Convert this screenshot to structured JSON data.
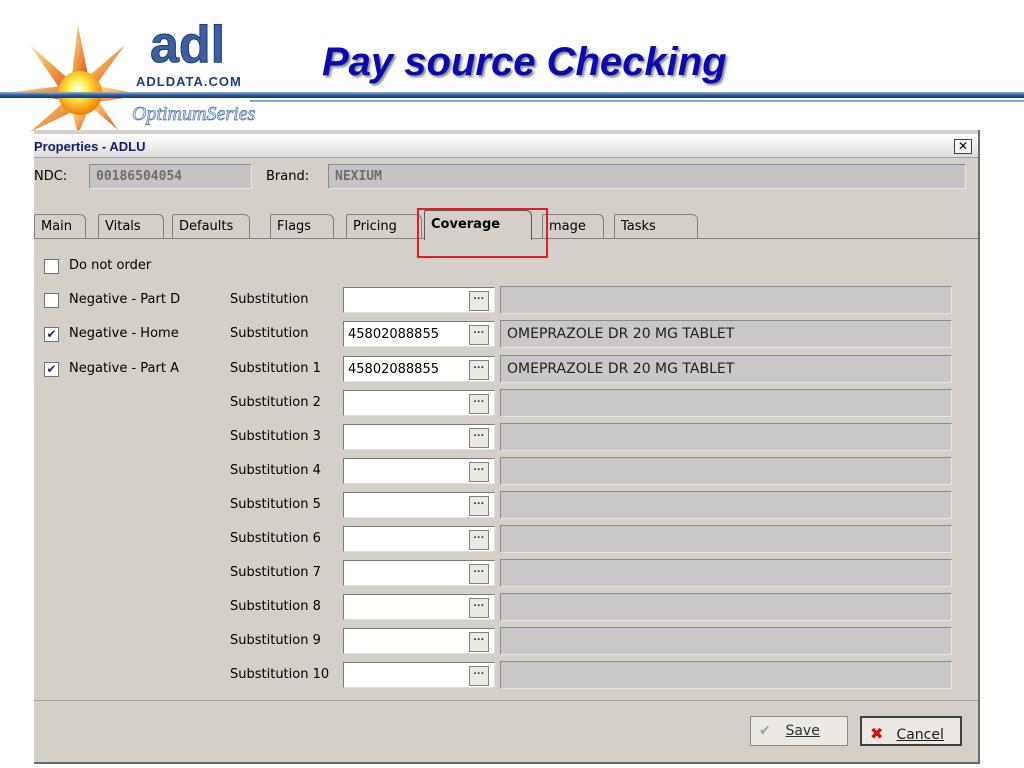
{
  "slide": {
    "title": "Pay source Checking",
    "logo": {
      "brand": "adl",
      "domain": "ADLDATA.COM",
      "series": "OptimumSeries"
    }
  },
  "window": {
    "title": "Properties - ADLU",
    "close_glyph": "✕",
    "ndc_label": "NDC:",
    "ndc_value": "00186504054",
    "brand_label": "Brand:",
    "brand_value": "NEXIUM"
  },
  "tabs": [
    {
      "label": "Main"
    },
    {
      "label": "Vitals"
    },
    {
      "label": "Defaults"
    },
    {
      "label": "Flags"
    },
    {
      "label": "Pricing"
    },
    {
      "label": "Coverage",
      "active": true
    },
    {
      "label": "mage"
    },
    {
      "label": "Tasks"
    }
  ],
  "coverage": {
    "options": [
      {
        "label": "Do not order",
        "checked": false
      },
      {
        "label": "Negative - Part D",
        "checked": false
      },
      {
        "label": "Negative - Home",
        "checked": true
      },
      {
        "label": "Negative - Part A",
        "checked": true
      }
    ],
    "check_glyph": "✔",
    "ellipsis_glyph": "···",
    "substitutions": [
      {
        "label": "Substitution",
        "ndc": "",
        "description": ""
      },
      {
        "label": "Substitution",
        "ndc": "45802088855",
        "description": "OMEPRAZOLE DR 20 MG TABLET"
      },
      {
        "label": "Substitution 1",
        "ndc": "45802088855",
        "description": "OMEPRAZOLE DR 20 MG TABLET"
      },
      {
        "label": "Substitution 2",
        "ndc": "",
        "description": ""
      },
      {
        "label": "Substitution 3",
        "ndc": "",
        "description": ""
      },
      {
        "label": "Substitution 4",
        "ndc": "",
        "description": ""
      },
      {
        "label": "Substitution 5",
        "ndc": "",
        "description": ""
      },
      {
        "label": "Substitution 6",
        "ndc": "",
        "description": ""
      },
      {
        "label": "Substitution 7",
        "ndc": "",
        "description": ""
      },
      {
        "label": "Substitution 8",
        "ndc": "",
        "description": ""
      },
      {
        "label": "Substitution 9",
        "ndc": "",
        "description": ""
      },
      {
        "label": "Substitution 10",
        "ndc": "",
        "description": ""
      }
    ]
  },
  "footer": {
    "save_label": "Save",
    "cancel_label": "Cancel",
    "save_glyph": "✔",
    "cancel_glyph": "✖"
  },
  "colors": {
    "title": "#0a0ab0",
    "highlight": "#e02020",
    "window_bg": "#d4d0c8",
    "readonly_field": "#c4c4c4",
    "cancel_icon": "#cc1010",
    "save_icon": "#9aa09a"
  }
}
